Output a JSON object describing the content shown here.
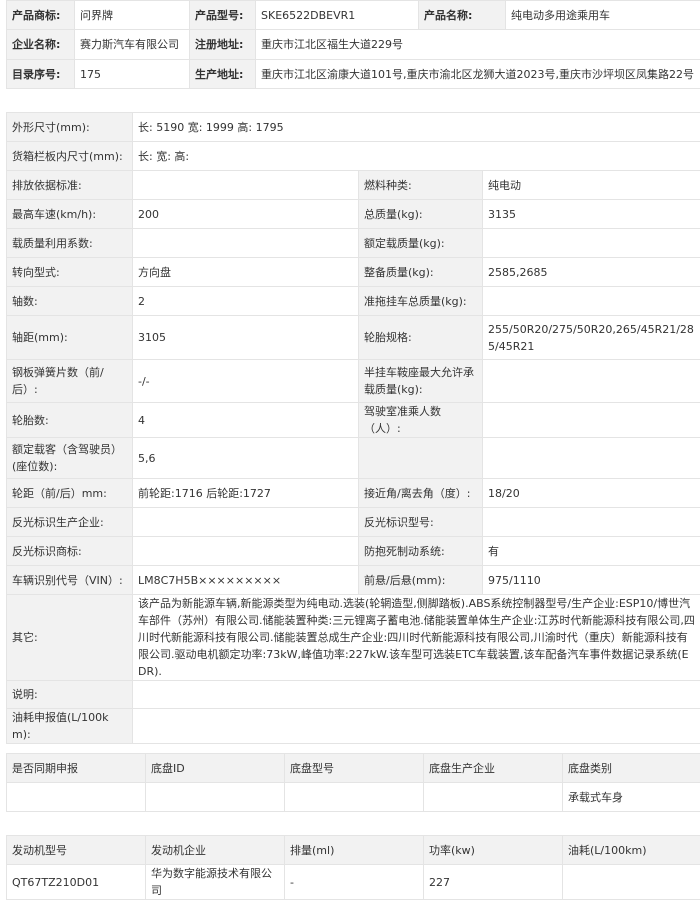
{
  "basic": {
    "product_brand_label": "产品商标:",
    "product_brand": "问界牌",
    "product_model_label": "产品型号:",
    "product_model": "SKE6522DBEVR1",
    "product_name_label": "产品名称:",
    "product_name": "纯电动多用途乘用车",
    "company_label": "企业名称:",
    "company": "赛力斯汽车有限公司",
    "reg_addr_label": "注册地址:",
    "reg_addr": "重庆市江北区福生大道229号",
    "catalog_label": "目录序号:",
    "catalog": "175",
    "prod_addr_label": "生产地址:",
    "prod_addr": "重庆市江北区渝康大道101号,重庆市渝北区龙狮大道2023号,重庆市沙坪坝区凤集路22号"
  },
  "specs": {
    "dims_label": "外形尺寸(mm):",
    "dims": "长: 5190 宽: 1999 高: 1795",
    "cargo_label": "货箱栏板内尺寸(mm):",
    "cargo": "长: 宽: 高:",
    "emission_label": "排放依据标准:",
    "emission": "",
    "fuel_label": "燃料种类:",
    "fuel": "纯电动",
    "speed_label": "最高车速(km/h):",
    "speed": "200",
    "total_mass_label": "总质量(kg):",
    "total_mass": "3135",
    "load_util_label": "载质量利用系数:",
    "load_util": "",
    "rated_load_label": "额定载质量(kg):",
    "rated_load": "",
    "steering_label": "转向型式:",
    "steering": "方向盘",
    "curb_label": "整备质量(kg):",
    "curb": "2585,2685",
    "axles_label": "轴数:",
    "axles": "2",
    "trailer_label": "准拖挂车总质量(kg):",
    "trailer": "",
    "wheelbase_label": "轴距(mm):",
    "wheelbase": "3105",
    "tires_label": "轮胎规格:",
    "tires": "255/50R20/275/50R20,265/45R21/285/45R21",
    "springs_label": "钢板弹簧片数（前/后）:",
    "springs": "-/-",
    "semi_label": "半挂车鞍座最大允许承载质量(kg):",
    "semi": "",
    "tire_count_label": "轮胎数:",
    "tire_count": "4",
    "cab_label": "驾驶室准乘人数（人）:",
    "cab": "",
    "seats_label": "额定载客（含驾驶员）(座位数):",
    "seats": "5,6",
    "track_label": "轮距（前/后）mm:",
    "track": "前轮距:1716 后轮距:1727",
    "angles_label": "接近角/离去角（度）:",
    "angles": "18/20",
    "refl_co_label": "反光标识生产企业:",
    "refl_co": "",
    "refl_model_label": "反光标识型号:",
    "refl_model": "",
    "refl_brand_label": "反光标识商标:",
    "refl_brand": "",
    "abs_label": "防抱死制动系统:",
    "abs": "有",
    "vin_label": "车辆识别代号（VIN）:",
    "vin": "LM8C7H5B×××××××××",
    "overhang_label": "前悬/后悬(mm):",
    "overhang": "975/1110",
    "other_label": "其它:",
    "other": "该产品为新能源车辆,新能源类型为纯电动.选装(轮辋造型,侧脚踏板).ABS系统控制器型号/生产企业:ESP10/博世汽车部件（苏州）有限公司.储能装置种类:三元锂离子蓄电池.储能装置单体生产企业:江苏时代新能源科技有限公司,四川时代新能源科技有限公司.储能装置总成生产企业:四川时代新能源科技有限公司,川渝时代（重庆）新能源科技有限公司.驱动电机额定功率:73kW,峰值功率:227kW.该车型可选装ETC车载装置,该车配备汽车事件数据记录系统(EDR).",
    "note_label": "说明:",
    "note": "",
    "fuel_cons_label": "油耗申报值(L/100km):",
    "fuel_cons": ""
  },
  "chassis": {
    "headers": [
      "是否同期申报",
      "底盘ID",
      "底盘型号",
      "底盘生产企业",
      "底盘类别"
    ],
    "row": [
      "",
      "",
      "",
      "",
      "承载式车身"
    ]
  },
  "engine": {
    "headers": [
      "发动机型号",
      "发动机企业",
      "排量(ml)",
      "功率(kw)",
      "油耗(L/100km)"
    ],
    "row": [
      "QT67TZ210D01",
      "华为数字能源技术有限公司",
      "-",
      "227",
      ""
    ]
  }
}
